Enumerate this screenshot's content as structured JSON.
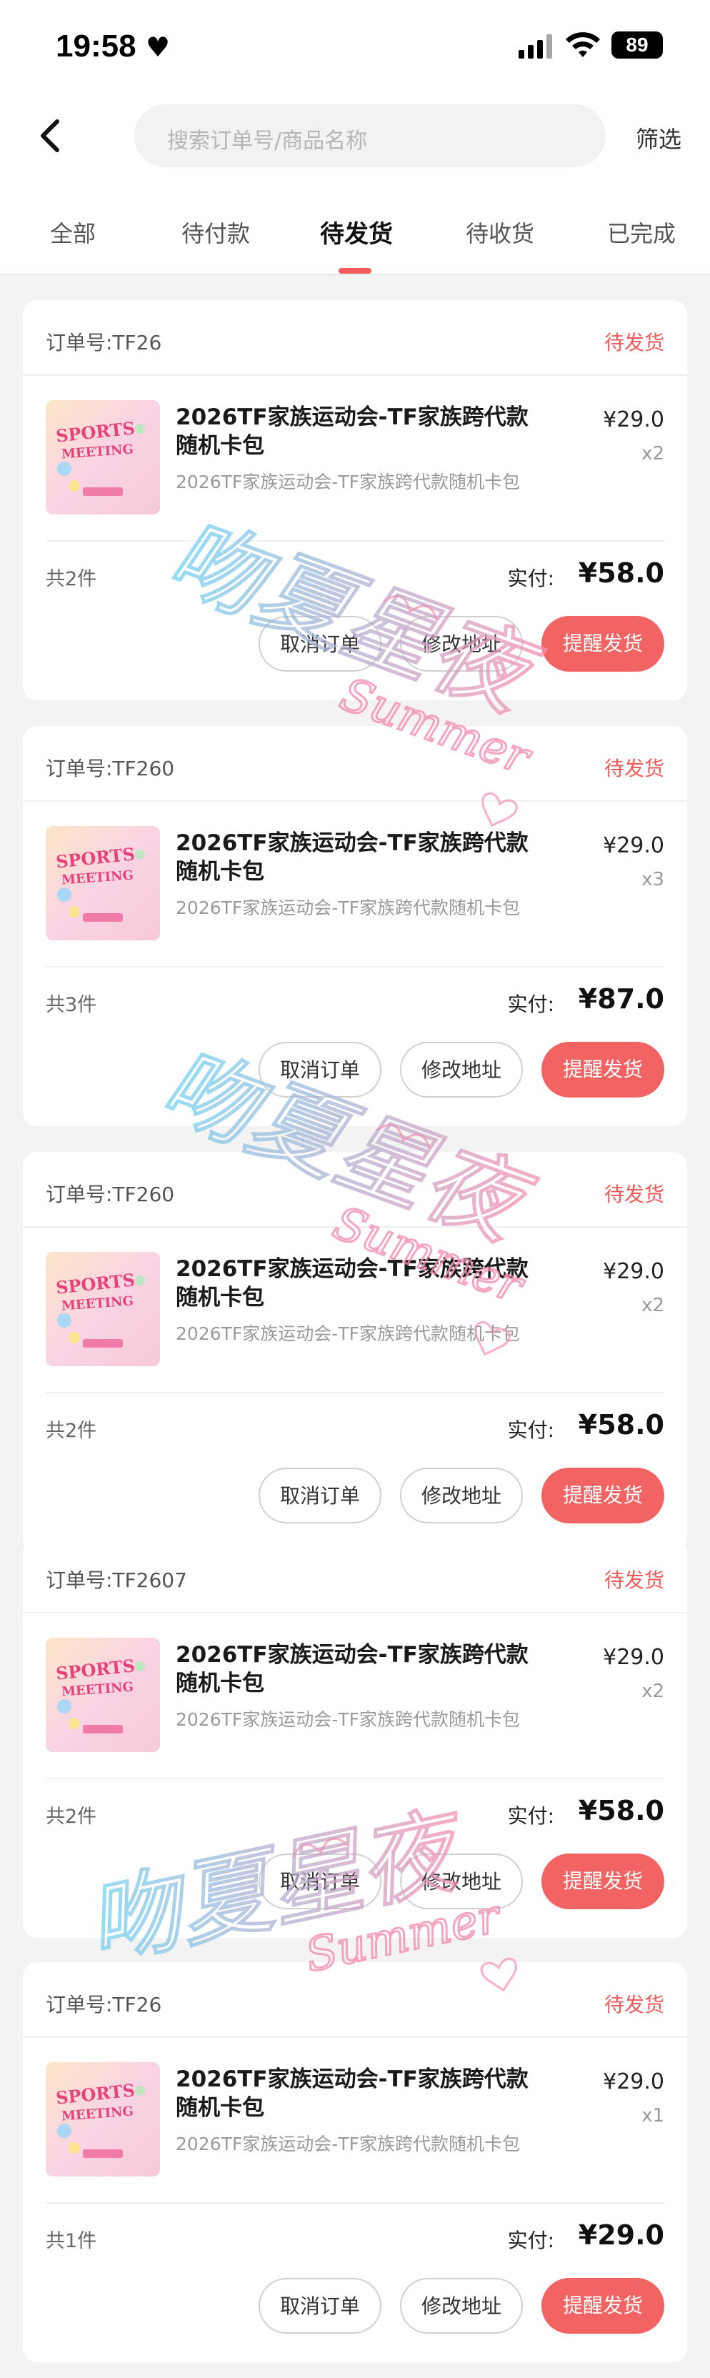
{
  "status_bar": {
    "time": "19:58",
    "battery": "89"
  },
  "search": {
    "placeholder": "搜索订单号/商品名称"
  },
  "header": {
    "filter_label": "筛选"
  },
  "tabs": [
    {
      "label": "全部"
    },
    {
      "label": "待付款"
    },
    {
      "label": "待发货",
      "active": true
    },
    {
      "label": "待收货"
    },
    {
      "label": "已完成"
    }
  ],
  "buttons": {
    "cancel": "取消订单",
    "address": "修改地址",
    "remind": "提醒发货"
  },
  "labels": {
    "paid": "实付:"
  },
  "product_art": {
    "line1": "SPORTS",
    "line2": "MEETING"
  },
  "orders": [
    {
      "order_no": "订单号:TF26",
      "status": "待发货",
      "title": "2026TF家族运动会-TF家族跨代款随机卡包",
      "subtitle": "2026TF家族运动会-TF家族跨代款随机卡包",
      "unit_price": "¥29.0",
      "quantity": "x2",
      "total_count": "共2件",
      "paid": "¥58.0"
    },
    {
      "order_no": "订单号:TF260",
      "status": "待发货",
      "title": "2026TF家族运动会-TF家族跨代款随机卡包",
      "subtitle": "2026TF家族运动会-TF家族跨代款随机卡包",
      "unit_price": "¥29.0",
      "quantity": "x3",
      "total_count": "共3件",
      "paid": "¥87.0"
    },
    {
      "order_no": "订单号:TF260",
      "status": "待发货",
      "title": "2026TF家族运动会-TF家族跨代款随机卡包",
      "subtitle": "2026TF家族运动会-TF家族跨代款随机卡包",
      "unit_price": "¥29.0",
      "quantity": "x2",
      "total_count": "共2件",
      "paid": "¥58.0"
    },
    {
      "order_no": "订单号:TF2607",
      "status": "待发货",
      "title": "2026TF家族运动会-TF家族跨代款随机卡包",
      "subtitle": "2026TF家族运动会-TF家族跨代款随机卡包",
      "unit_price": "¥29.0",
      "quantity": "x2",
      "total_count": "共2件",
      "paid": "¥58.0"
    },
    {
      "order_no": "订单号:TF26",
      "status": "待发货",
      "title": "2026TF家族运动会-TF家族跨代款随机卡包",
      "subtitle": "2026TF家族运动会-TF家族跨代款随机卡包",
      "unit_price": "¥29.0",
      "quantity": "x1",
      "total_count": "共1件",
      "paid": "¥29.0"
    }
  ],
  "watermark": {
    "text": "吻夏星夜",
    "latin": "Summer"
  },
  "colors": {
    "accent": "#f15b5b",
    "button_red": "#f26363",
    "page_bg": "#f3f3f3"
  }
}
